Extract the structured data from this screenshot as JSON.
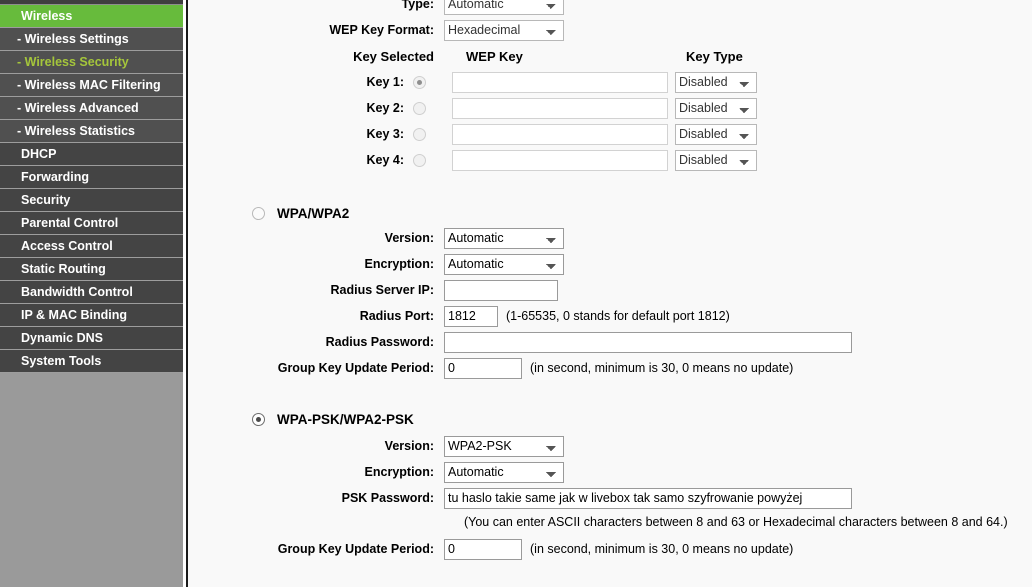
{
  "sidebar": {
    "items": [
      {
        "label": "Wireless",
        "level": 0,
        "state": "active-green"
      },
      {
        "label": "- Wireless Settings",
        "level": 1,
        "state": "normal"
      },
      {
        "label": "- Wireless Security",
        "level": 1,
        "state": "active-text"
      },
      {
        "label": "- Wireless MAC Filtering",
        "level": 1,
        "state": "normal"
      },
      {
        "label": "- Wireless Advanced",
        "level": 1,
        "state": "normal"
      },
      {
        "label": "- Wireless Statistics",
        "level": 1,
        "state": "normal"
      },
      {
        "label": "DHCP",
        "level": 0,
        "state": "normal"
      },
      {
        "label": "Forwarding",
        "level": 0,
        "state": "normal"
      },
      {
        "label": "Security",
        "level": 0,
        "state": "normal"
      },
      {
        "label": "Parental Control",
        "level": 0,
        "state": "normal"
      },
      {
        "label": "Access Control",
        "level": 0,
        "state": "normal"
      },
      {
        "label": "Static Routing",
        "level": 0,
        "state": "normal"
      },
      {
        "label": "Bandwidth Control",
        "level": 0,
        "state": "normal"
      },
      {
        "label": "IP & MAC Binding",
        "level": 0,
        "state": "normal"
      },
      {
        "label": "Dynamic DNS",
        "level": 0,
        "state": "normal"
      },
      {
        "label": "System Tools",
        "level": 0,
        "state": "normal"
      }
    ]
  },
  "wep": {
    "type_label": "Type:",
    "type_value": "Automatic",
    "key_format_label": "WEP Key Format:",
    "key_format_value": "Hexadecimal",
    "col_key_selected": "Key Selected",
    "col_wep_key": "WEP Key",
    "col_key_type": "Key Type",
    "keys": [
      {
        "label": "Key 1:",
        "selected": true,
        "value": "",
        "key_type": "Disabled"
      },
      {
        "label": "Key 2:",
        "selected": false,
        "value": "",
        "key_type": "Disabled"
      },
      {
        "label": "Key 3:",
        "selected": false,
        "value": "",
        "key_type": "Disabled"
      },
      {
        "label": "Key 4:",
        "selected": false,
        "value": "",
        "key_type": "Disabled"
      }
    ]
  },
  "wpa": {
    "section_label": "WPA/WPA2",
    "selected": false,
    "version_label": "Version:",
    "version_value": "Automatic",
    "encryption_label": "Encryption:",
    "encryption_value": "Automatic",
    "radius_ip_label": "Radius Server IP:",
    "radius_ip_value": "",
    "radius_port_label": "Radius Port:",
    "radius_port_value": "1812",
    "radius_port_note": "(1-65535, 0 stands for default port 1812)",
    "radius_password_label": "Radius Password:",
    "radius_password_value": "",
    "group_key_label": "Group Key Update Period:",
    "group_key_value": "0",
    "group_key_note": "(in second, minimum is 30, 0 means no update)"
  },
  "wpapsk": {
    "section_label": "WPA-PSK/WPA2-PSK",
    "selected": true,
    "version_label": "Version:",
    "version_value": "WPA2-PSK",
    "encryption_label": "Encryption:",
    "encryption_value": "Automatic",
    "psk_password_label": "PSK Password:",
    "psk_password_value": "tu haslo takie same jak w livebox tak samo szyfrowanie powyżej",
    "psk_note": "(You can enter ASCII characters between 8 and 63 or Hexadecimal characters between 8 and 64.)",
    "group_key_label": "Group Key Update Period:",
    "group_key_value": "0",
    "group_key_note": "(in second, minimum is 30, 0 means no update)"
  },
  "colors": {
    "accent_green": "#67bb3c",
    "accent_text_green": "#a5c63b",
    "sidebar_dark": "#444444",
    "sidebar_sub": "#505050",
    "sidebar_base": "#9a9a9a",
    "content_bg": "#f9f9f9"
  }
}
